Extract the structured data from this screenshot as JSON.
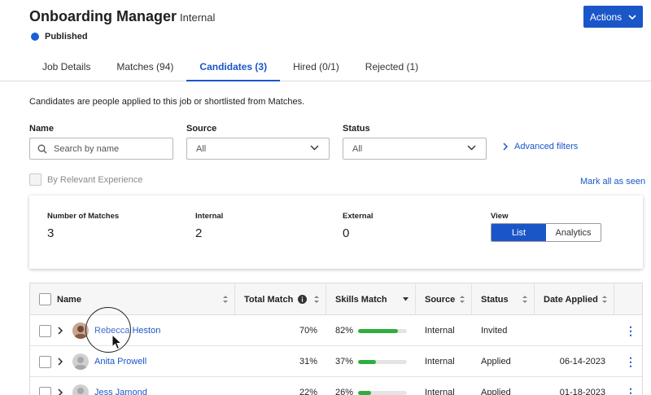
{
  "header": {
    "title": "Onboarding Manager",
    "subtitle": "Internal",
    "status": "Published",
    "actions_label": "Actions"
  },
  "tabs": [
    {
      "label": "Job Details"
    },
    {
      "label": "Matches (94)"
    },
    {
      "label": "Candidates (3)"
    },
    {
      "label": "Hired (0/1)"
    },
    {
      "label": "Rejected (1)"
    }
  ],
  "description": "Candidates are people applied to this job or shortlisted from Matches.",
  "filters": {
    "name_label": "Name",
    "name_placeholder": "Search by name",
    "source_label": "Source",
    "source_value": "All",
    "status_label": "Status",
    "status_value": "All",
    "advanced_label": "Advanced filters",
    "relevant_label": "By Relevant Experience",
    "mark_all_label": "Mark all as seen"
  },
  "stats": {
    "matches_label": "Number of Matches",
    "matches_value": "3",
    "internal_label": "Internal",
    "internal_value": "2",
    "external_label": "External",
    "external_value": "0",
    "view_label": "View",
    "view_list": "List",
    "view_analytics": "Analytics"
  },
  "table": {
    "headers": {
      "name": "Name",
      "total_match": "Total Match",
      "skills_match": "Skills Match",
      "source": "Source",
      "status": "Status",
      "date_applied": "Date Applied"
    },
    "rows": [
      {
        "name": "Rebecca Heston",
        "total": "70%",
        "skills": "82%",
        "skills_pct": 82,
        "source": "Internal",
        "status": "Invited",
        "date": ""
      },
      {
        "name": "Anita Prowell",
        "total": "31%",
        "skills": "37%",
        "skills_pct": 37,
        "source": "Internal",
        "status": "Applied",
        "date": "06-14-2023"
      },
      {
        "name": "Jess Jamond",
        "total": "22%",
        "skills": "26%",
        "skills_pct": 26,
        "source": "Internal",
        "status": "Applied",
        "date": "01-18-2023"
      }
    ]
  },
  "colors": {
    "accent": "#1a56c8",
    "bar": "#2eae3e"
  }
}
